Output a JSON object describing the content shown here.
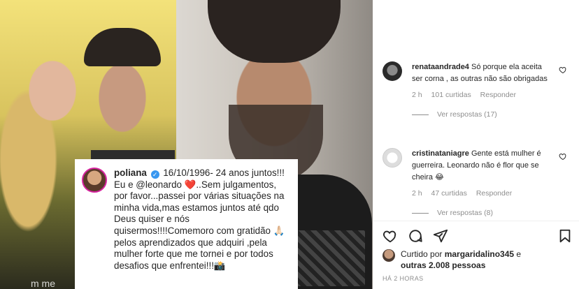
{
  "post": {
    "caption": {
      "username": "poliana",
      "verified_icon": "verified-badge-icon",
      "text_before_mention": "16/10/1996- 24 anos juntos!!! Eu e ",
      "mention": "@leonardo",
      "heart_icon": "red-heart-emoji",
      "text_after_mention": "..Sem julgamentos, por favor...passei por várias situações na minha vida,mas estamos juntos até qdo Deus quiser e nós quisermos!!!!Comemoro com gratidão 🙏🏻pelos aprendizados que adquiri ,pela mulher forte que me tornei e por todos desafios que enfrentei!!!📸"
    },
    "overlay_text": "m me"
  },
  "comments": [
    {
      "username": "renataandrade4",
      "text": "Só porque ela aceita ser corna , as outras não são obrigadas",
      "time": "2 h",
      "likes": "101 curtidas",
      "reply_label": "Responder",
      "view_replies": "Ver respostas (17)"
    },
    {
      "username": "cristinataniagre",
      "text": "Gente está mulher é guerreira. Leonardo não é flor que se cheira 😂",
      "time": "2 h",
      "likes": "47 curtidas",
      "reply_label": "Responder",
      "view_replies": "Ver respostas (8)"
    }
  ],
  "actions": {
    "liked_by_prefix": "Curtido por ",
    "liked_by_user": "margaridalino345",
    "liked_by_conj": " e",
    "liked_by_others": "outras 2.008 pessoas",
    "timestamp": "HÁ 2 HORAS"
  },
  "colors": {
    "verified": "#3897f0",
    "muted": "#8e8e8e",
    "text": "#262626"
  }
}
